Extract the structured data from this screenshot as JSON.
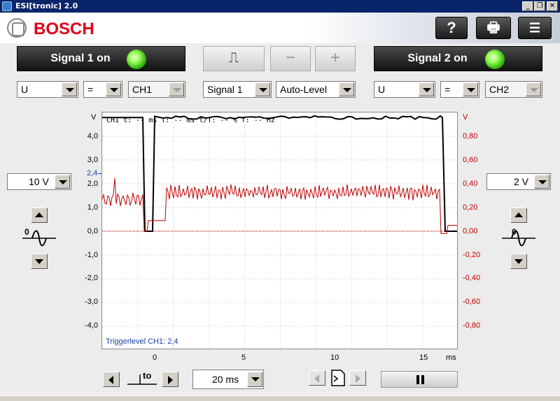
{
  "window": {
    "title": "ESI[tronic] 2.0",
    "min": "_",
    "restore": "❐",
    "close": "✕"
  },
  "header": {
    "brand": "BOSCH",
    "help_label": "?",
    "print_label": "🖶",
    "export_label": "☰"
  },
  "signal1": {
    "label": "Signal 1 on",
    "status_color": "#3fc01a"
  },
  "signal2": {
    "label": "Signal 2 on",
    "status_color": "#3fc01a"
  },
  "trigger_buttons": {
    "edge_label": "⎍",
    "minus_label": "−",
    "plus_label": "+"
  },
  "ch1_controls": {
    "quantity": "U",
    "coupling": "=",
    "channel": "CH1"
  },
  "trigger_controls": {
    "source": "Signal 1",
    "mode": "Auto-Level"
  },
  "ch2_controls": {
    "quantity": "U",
    "coupling": "=",
    "channel": "CH2"
  },
  "ch1_range": "10 V",
  "ch2_range": "2 V",
  "scope": {
    "info": "CH1  t: -- ms  T: -- ms  t/T: -- %  f: -- Hz",
    "trigger_text": "Triggerlevel CH1: 2,4",
    "left_unit": "V",
    "right_unit": "V",
    "x_unit": "ms",
    "trigger_marker": "2,4",
    "left_ticks": [
      "4,0",
      "3,0",
      "2,0",
      "1,0",
      "0,0",
      "-1,0",
      "-2,0",
      "-3,0",
      "-4,0"
    ],
    "right_ticks": [
      "0,80",
      "0,60",
      "0,40",
      "0,20",
      "0,00",
      "-0,20",
      "-0,40",
      "-0,60",
      "-0,80"
    ],
    "x_ticks": [
      "0",
      "5",
      "10",
      "15"
    ]
  },
  "timebase": {
    "to_label": "to",
    "value": "20 ms"
  },
  "colors": {
    "ch1": "#000000",
    "ch2": "#c00000",
    "grid": "#c8c8c8"
  }
}
